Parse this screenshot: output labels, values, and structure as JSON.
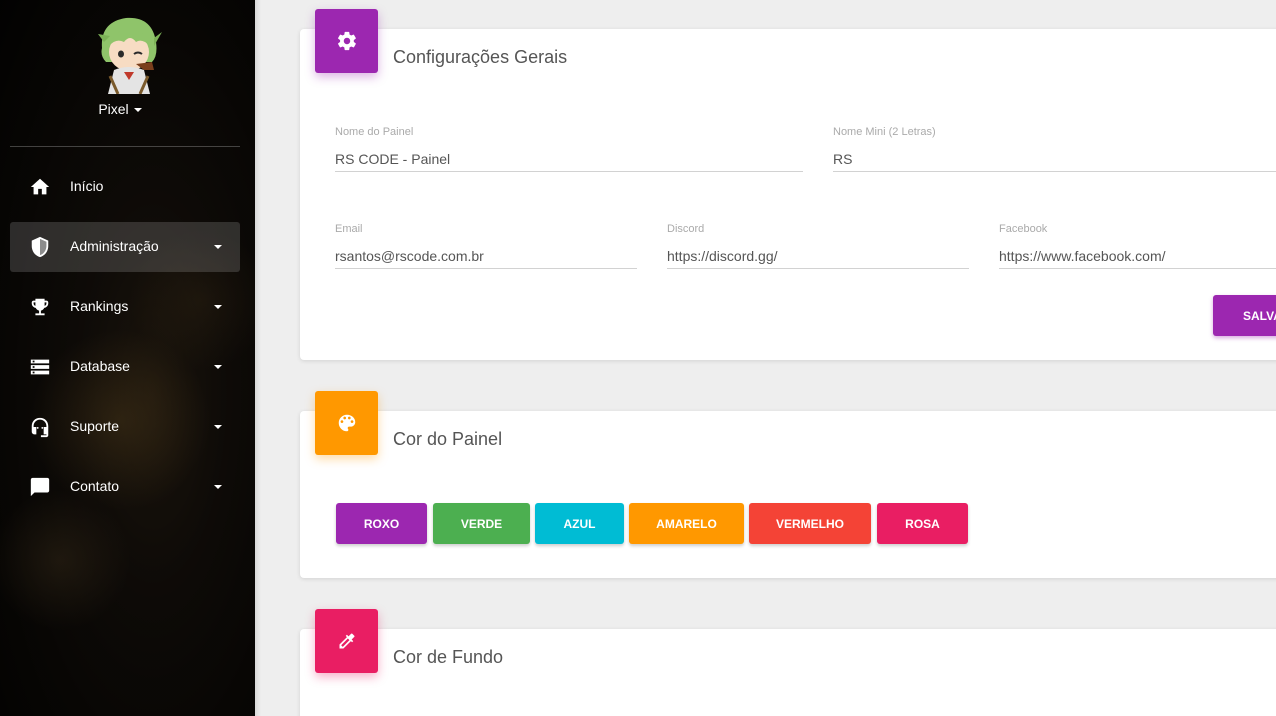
{
  "sidebar": {
    "user": {
      "name": "Pixel"
    },
    "items": [
      {
        "label": "Início",
        "icon": "home-icon",
        "has_caret": false,
        "active": false
      },
      {
        "label": "Administração",
        "icon": "shield-icon",
        "has_caret": true,
        "active": true
      },
      {
        "label": "Rankings",
        "icon": "trophy-icon",
        "has_caret": true,
        "active": false
      },
      {
        "label": "Database",
        "icon": "storage-icon",
        "has_caret": true,
        "active": false
      },
      {
        "label": "Suporte",
        "icon": "headset-icon",
        "has_caret": true,
        "active": false
      },
      {
        "label": "Contato",
        "icon": "chat-icon",
        "has_caret": true,
        "active": false
      }
    ]
  },
  "general": {
    "title": "Configurações Gerais",
    "icon": "gear-icon",
    "icon_color": "#9c27b0",
    "fields": {
      "panel_name": {
        "label": "Nome do Painel",
        "value": "RS CODE - Painel"
      },
      "mini_name": {
        "label": "Nome Mini (2 Letras)",
        "value": "RS"
      },
      "email": {
        "label": "Email",
        "value": "rsantos@rscode.com.br"
      },
      "discord": {
        "label": "Discord",
        "value": "https://discord.gg/"
      },
      "facebook": {
        "label": "Facebook",
        "value": "https://www.facebook.com/"
      }
    },
    "save_label": "SALVA"
  },
  "panel_color": {
    "title": "Cor do Painel",
    "icon": "palette-icon",
    "icon_color": "#ff9800",
    "options": [
      {
        "label": "ROXO",
        "color": "#9c27b0"
      },
      {
        "label": "VERDE",
        "color": "#4caf50"
      },
      {
        "label": "AZUL",
        "color": "#00bcd4"
      },
      {
        "label": "AMARELO",
        "color": "#ff9800"
      },
      {
        "label": "VERMELHO",
        "color": "#f44336"
      },
      {
        "label": "ROSA",
        "color": "#e91e63"
      }
    ]
  },
  "background_color": {
    "title": "Cor de Fundo",
    "icon": "eyedropper-icon",
    "icon_color": "#e91e63"
  }
}
